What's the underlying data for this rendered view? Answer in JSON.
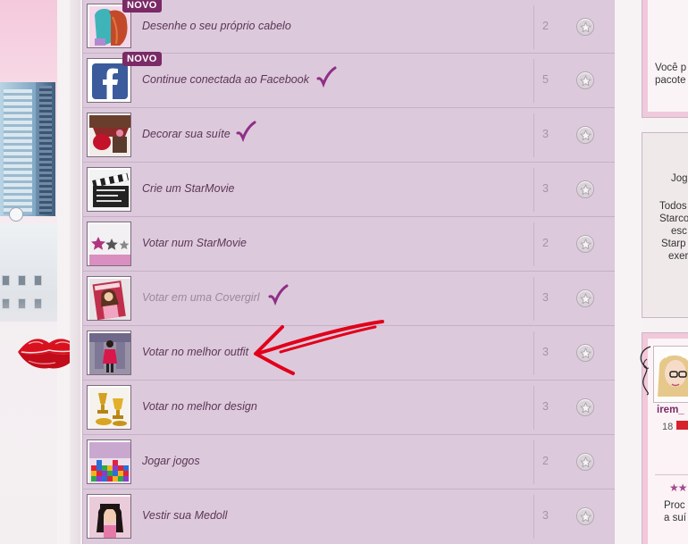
{
  "badges": {
    "new_label": "NOVO"
  },
  "activities": [
    {
      "title": "Desenhe o seu próprio cabelo",
      "count": "2",
      "is_new": true,
      "checked": false,
      "dim": false,
      "thumb_icon": "hair-design-icon"
    },
    {
      "title": "Continue conectada ao Facebook",
      "count": "5",
      "is_new": true,
      "checked": true,
      "dim": false,
      "thumb_icon": "facebook-icon"
    },
    {
      "title": "Decorar sua suíte",
      "count": "3",
      "is_new": false,
      "checked": true,
      "dim": false,
      "thumb_icon": "suite-decor-icon"
    },
    {
      "title": "Crie um StarMovie",
      "count": "3",
      "is_new": false,
      "checked": false,
      "dim": false,
      "thumb_icon": "clapperboard-icon"
    },
    {
      "title": "Votar num StarMovie",
      "count": "2",
      "is_new": false,
      "checked": false,
      "dim": false,
      "thumb_icon": "rating-stars-icon"
    },
    {
      "title": "Votar em uma Covergirl",
      "count": "3",
      "is_new": false,
      "checked": true,
      "dim": true,
      "thumb_icon": "magazine-cover-icon"
    },
    {
      "title": "Votar no melhor outfit",
      "count": "3",
      "is_new": false,
      "checked": false,
      "dim": false,
      "thumb_icon": "outfit-icon"
    },
    {
      "title": "Votar no melhor design",
      "count": "3",
      "is_new": false,
      "checked": false,
      "dim": false,
      "thumb_icon": "trophies-icon"
    },
    {
      "title": "Jogar jogos",
      "count": "2",
      "is_new": false,
      "checked": false,
      "dim": false,
      "thumb_icon": "game-blocks-icon"
    },
    {
      "title": "Vestir sua Medoll",
      "count": "3",
      "is_new": false,
      "checked": false,
      "dim": false,
      "thumb_icon": "medoll-icon"
    }
  ],
  "right_panel": {
    "pink_card": {
      "line1": "Você p",
      "line2": "pacote"
    },
    "grey_card": {
      "l1": "Jog",
      "l2": "Todos",
      "l3": "Starco",
      "l4": "esc",
      "l5": "Starp",
      "l6": "exer"
    },
    "profile": {
      "name": "irem_",
      "age": "18",
      "line1": "Proc",
      "line2": "a suí"
    }
  },
  "colors": {
    "accent": "#7a2a66",
    "panel": "#ddc9dc",
    "check": "#8e2f86",
    "arrow": "#e1001a"
  }
}
